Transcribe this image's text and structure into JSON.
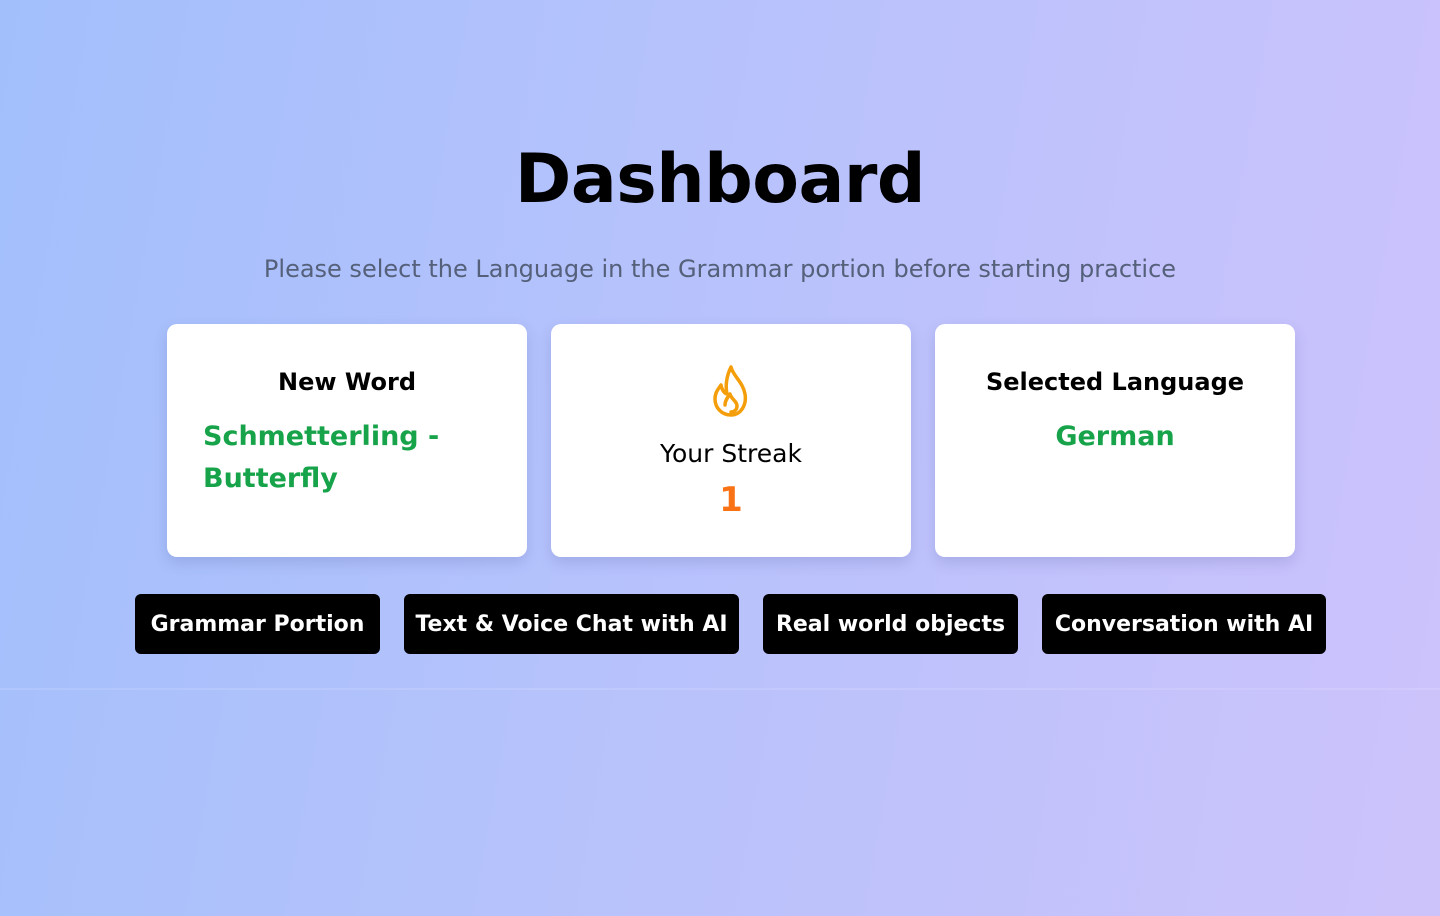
{
  "page": {
    "title": "Dashboard",
    "subtitle": "Please select the Language in the Grammar portion before starting practice"
  },
  "cards": {
    "new_word": {
      "heading": "New Word",
      "value": "Schmetterling - Butterfly"
    },
    "streak": {
      "icon": "flame-icon",
      "label": "Your Streak",
      "count": "1"
    },
    "language": {
      "heading": "Selected Language",
      "value": "German"
    }
  },
  "actions": [
    {
      "label": "Grammar Portion"
    },
    {
      "label": "Text & Voice Chat with AI"
    },
    {
      "label": "Real world objects"
    },
    {
      "label": "Conversation with AI"
    }
  ],
  "colors": {
    "accent_green": "#17a34a",
    "streak_orange": "#f97316",
    "flame_stroke": "#f59e0b",
    "button_bg": "#000000"
  }
}
